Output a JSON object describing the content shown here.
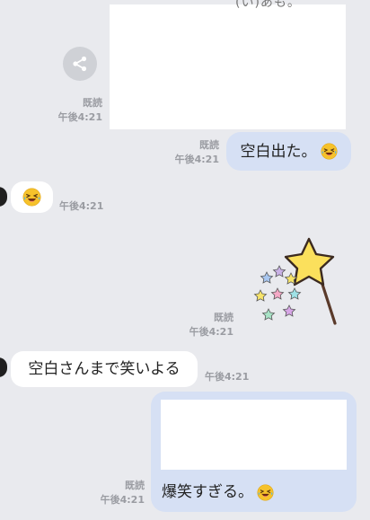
{
  "top_block": {
    "partial_text": "(い)あも。"
  },
  "messages": [
    {
      "id": "m1",
      "side": "out",
      "type": "image",
      "read_label": "既読",
      "time": "午後4:21"
    },
    {
      "id": "m2",
      "side": "out",
      "type": "text",
      "text": "空白出た。",
      "emoji": "rolling-laughing-emoji",
      "read_label": "既読",
      "time": "午後4:21"
    },
    {
      "id": "m3",
      "side": "in",
      "type": "emoji",
      "emoji": "rolling-laughing-emoji",
      "time": "午後4:21"
    },
    {
      "id": "m4",
      "side": "out",
      "type": "sticker",
      "sticker": "star-wand-sticker",
      "read_label": "既読",
      "time": "午後4:21"
    },
    {
      "id": "m5",
      "side": "in",
      "type": "text",
      "text": "空白さんまで笑いよる",
      "time": "午後4:21"
    },
    {
      "id": "m6",
      "side": "out",
      "type": "quote",
      "text": "爆笑すぎる。",
      "emoji": "rolling-laughing-emoji",
      "read_label": "既読",
      "time": "午後4:21"
    }
  ],
  "icons": {
    "share": "share-icon"
  },
  "colors": {
    "background": "#e9eaee",
    "out_bubble": "#d6e0f4",
    "in_bubble": "#ffffff",
    "meta_text": "#9a9ca2"
  }
}
